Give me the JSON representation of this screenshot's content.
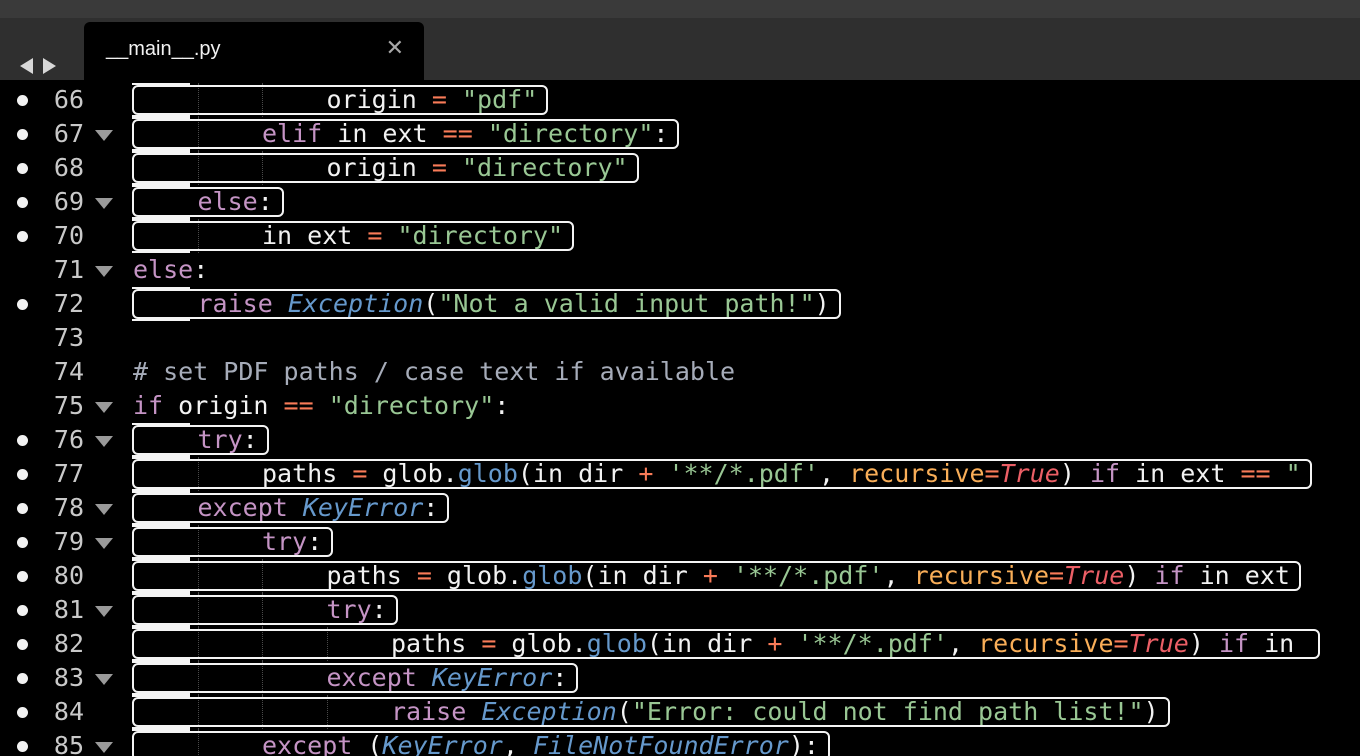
{
  "tab": {
    "title": "__main__.py"
  },
  "lines": [
    {
      "n": "66",
      "dot": true,
      "fold": false,
      "ind": 3,
      "tokens": [
        [
          "",
          "origin "
        ],
        [
          "op",
          "="
        ],
        [
          "",
          " "
        ],
        [
          "str",
          "\"pdf\""
        ]
      ]
    },
    {
      "n": "67",
      "dot": true,
      "fold": true,
      "ind": 2,
      "tokens": [
        [
          "kw",
          "elif"
        ],
        [
          "",
          " in_ext "
        ],
        [
          "op",
          "=="
        ],
        [
          "",
          " "
        ],
        [
          "str",
          "\"directory\""
        ],
        [
          "",
          ":"
        ]
      ]
    },
    {
      "n": "68",
      "dot": true,
      "fold": false,
      "ind": 3,
      "tokens": [
        [
          "",
          "origin "
        ],
        [
          "op",
          "="
        ],
        [
          "",
          " "
        ],
        [
          "str",
          "\"directory\""
        ]
      ]
    },
    {
      "n": "69",
      "dot": true,
      "fold": true,
      "ind": 1,
      "tokens": [
        [
          "kw",
          "else"
        ],
        [
          "",
          ":"
        ]
      ]
    },
    {
      "n": "70",
      "dot": true,
      "fold": false,
      "ind": 2,
      "tokens": [
        [
          "",
          "in_ext "
        ],
        [
          "op",
          "="
        ],
        [
          "",
          " "
        ],
        [
          "str",
          "\"directory\""
        ]
      ]
    },
    {
      "n": "71",
      "dot": false,
      "fold": true,
      "ind": 0,
      "tokens": [
        [
          "kw",
          "else"
        ],
        [
          "",
          ":"
        ]
      ]
    },
    {
      "n": "72",
      "dot": true,
      "fold": false,
      "ind": 1,
      "tokens": [
        [
          "kw",
          "raise"
        ],
        [
          "",
          " "
        ],
        [
          "cls",
          "Exception"
        ],
        [
          "",
          "("
        ],
        [
          "str",
          "\"Not a valid input path!\""
        ],
        [
          "",
          ")"
        ]
      ]
    },
    {
      "n": "73",
      "dot": false,
      "fold": false,
      "ind": 0,
      "tokens": []
    },
    {
      "n": "74",
      "dot": false,
      "fold": false,
      "ind": 0,
      "tokens": [
        [
          "cm",
          "# set PDF paths / case text if available"
        ]
      ]
    },
    {
      "n": "75",
      "dot": false,
      "fold": true,
      "ind": 0,
      "tokens": [
        [
          "kw",
          "if"
        ],
        [
          "",
          " origin "
        ],
        [
          "op",
          "=="
        ],
        [
          "",
          " "
        ],
        [
          "str",
          "\"directory\""
        ],
        [
          "",
          ":"
        ]
      ]
    },
    {
      "n": "76",
      "dot": true,
      "fold": true,
      "ind": 1,
      "tokens": [
        [
          "kw",
          "try"
        ],
        [
          "",
          ":"
        ]
      ]
    },
    {
      "n": "77",
      "dot": true,
      "fold": false,
      "ind": 2,
      "tokens": [
        [
          "",
          "paths "
        ],
        [
          "op",
          "="
        ],
        [
          "",
          " glob."
        ],
        [
          "fn",
          "glob"
        ],
        [
          "",
          "(in_dir "
        ],
        [
          "op",
          "+"
        ],
        [
          "",
          " "
        ],
        [
          "str",
          "'**/*.pdf'"
        ],
        [
          "",
          ", "
        ],
        [
          "prm",
          "recursive"
        ],
        [
          "op",
          "="
        ],
        [
          "const",
          "True"
        ],
        [
          "",
          ") "
        ],
        [
          "kw",
          "if"
        ],
        [
          "",
          " in_ext "
        ],
        [
          "op",
          "=="
        ],
        [
          "",
          " "
        ],
        [
          "str",
          "\""
        ]
      ]
    },
    {
      "n": "78",
      "dot": true,
      "fold": true,
      "ind": 1,
      "tokens": [
        [
          "kw",
          "except"
        ],
        [
          "",
          " "
        ],
        [
          "cls",
          "KeyError"
        ],
        [
          "",
          ":"
        ]
      ]
    },
    {
      "n": "79",
      "dot": true,
      "fold": true,
      "ind": 2,
      "tokens": [
        [
          "kw",
          "try"
        ],
        [
          "",
          ":"
        ]
      ]
    },
    {
      "n": "80",
      "dot": true,
      "fold": false,
      "ind": 3,
      "tokens": [
        [
          "",
          "paths "
        ],
        [
          "op",
          "="
        ],
        [
          "",
          " glob."
        ],
        [
          "fn",
          "glob"
        ],
        [
          "",
          "(in_dir "
        ],
        [
          "op",
          "+"
        ],
        [
          "",
          " "
        ],
        [
          "str",
          "'**/*.pdf'"
        ],
        [
          "",
          ", "
        ],
        [
          "prm",
          "recursive"
        ],
        [
          "op",
          "="
        ],
        [
          "const",
          "True"
        ],
        [
          "",
          ") "
        ],
        [
          "kw",
          "if"
        ],
        [
          "",
          " in_ext"
        ]
      ]
    },
    {
      "n": "81",
      "dot": true,
      "fold": true,
      "ind": 3,
      "tokens": [
        [
          "kw",
          "try"
        ],
        [
          "",
          ":"
        ]
      ]
    },
    {
      "n": "82",
      "dot": true,
      "fold": false,
      "ind": 4,
      "tokens": [
        [
          "",
          "paths "
        ],
        [
          "op",
          "="
        ],
        [
          "",
          " glob."
        ],
        [
          "fn",
          "glob"
        ],
        [
          "",
          "(in_dir "
        ],
        [
          "op",
          "+"
        ],
        [
          "",
          " "
        ],
        [
          "str",
          "'**/*.pdf'"
        ],
        [
          "",
          ", "
        ],
        [
          "prm",
          "recursive"
        ],
        [
          "op",
          "="
        ],
        [
          "const",
          "True"
        ],
        [
          "",
          ") "
        ],
        [
          "kw",
          "if"
        ],
        [
          "",
          " in_"
        ]
      ]
    },
    {
      "n": "83",
      "dot": true,
      "fold": true,
      "ind": 3,
      "tokens": [
        [
          "kw",
          "except"
        ],
        [
          "",
          " "
        ],
        [
          "cls",
          "KeyError"
        ],
        [
          "",
          ":"
        ]
      ]
    },
    {
      "n": "84",
      "dot": true,
      "fold": false,
      "ind": 4,
      "tokens": [
        [
          "kw",
          "raise"
        ],
        [
          "",
          " "
        ],
        [
          "cls",
          "Exception"
        ],
        [
          "",
          "("
        ],
        [
          "str",
          "\"Error: could not find path list!\""
        ],
        [
          "",
          ")"
        ]
      ]
    },
    {
      "n": "85",
      "dot": true,
      "fold": true,
      "ind": 2,
      "tokens": [
        [
          "kw",
          "except"
        ],
        [
          "",
          " ("
        ],
        [
          "cls",
          "KeyError"
        ],
        [
          "",
          ", "
        ],
        [
          "cls",
          "FileNotFoundError"
        ],
        [
          "",
          "):"
        ]
      ]
    }
  ]
}
